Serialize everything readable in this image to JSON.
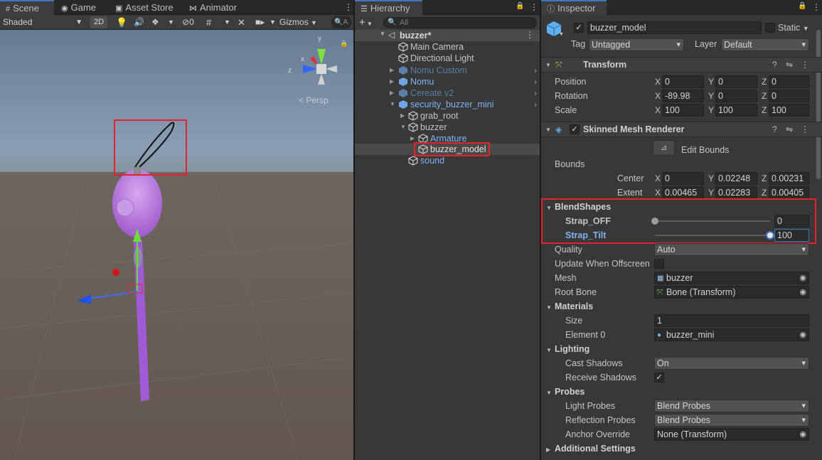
{
  "scene": {
    "tabs": [
      "Scene",
      "Game",
      "Asset Store",
      "Animator"
    ],
    "shading_mode": "Shaded",
    "toggle_2d": "2D",
    "hidden_count": "0",
    "gizmos_label": "Gizmos",
    "search_placeholder": "A",
    "gizmo_axis_y": "y",
    "gizmo_axis_x": "x",
    "gizmo_axis_z": "z",
    "persp_label": "< Persp"
  },
  "hierarchy": {
    "tab": "Hierarchy",
    "add_label": "+",
    "search_placeholder": "All",
    "scene_name": "buzzer*",
    "items": [
      {
        "label": "Main Camera"
      },
      {
        "label": "Directional Light"
      },
      {
        "label": "Nomu Custom"
      },
      {
        "label": "Nomu"
      },
      {
        "label": "Cereate v2"
      },
      {
        "label": "security_buzzer_mini"
      },
      {
        "label": "grab_root"
      },
      {
        "label": "buzzer"
      },
      {
        "label": "Armature"
      },
      {
        "label": "buzzer_model"
      },
      {
        "label": "sound"
      }
    ]
  },
  "inspector": {
    "tab": "Inspector",
    "object_name": "buzzer_model",
    "static_label": "Static",
    "tag_label": "Tag",
    "tag_value": "Untagged",
    "layer_label": "Layer",
    "layer_value": "Default",
    "transform": {
      "title": "Transform",
      "position_label": "Position",
      "rotation_label": "Rotation",
      "scale_label": "Scale",
      "position": [
        "0",
        "0",
        "0"
      ],
      "rotation": [
        "-89.98",
        "0",
        "0"
      ],
      "scale": [
        "100",
        "100",
        "100"
      ]
    },
    "smr": {
      "title": "Skinned Mesh Renderer",
      "edit_bounds": "Edit Bounds",
      "bounds_label": "Bounds",
      "center_label": "Center",
      "extent_label": "Extent",
      "center": [
        "0",
        "0.02248",
        "0.00231"
      ],
      "extent": [
        "0.00465",
        "0.02283",
        "0.00405"
      ],
      "blendshapes_label": "BlendShapes",
      "blendshapes": [
        {
          "name": "Strap_OFF",
          "value": "0",
          "fraction": 0.0
        },
        {
          "name": "Strap_Tilt",
          "value": "100",
          "fraction": 1.0
        }
      ],
      "quality_label": "Quality",
      "quality_value": "Auto",
      "update_offscreen_label": "Update When Offscreen",
      "mesh_label": "Mesh",
      "mesh_value": "buzzer",
      "root_bone_label": "Root Bone",
      "root_bone_value": "Bone (Transform)",
      "materials_label": "Materials",
      "size_label": "Size",
      "size_value": "1",
      "element0_label": "Element 0",
      "element0_value": "buzzer_mini",
      "lighting_label": "Lighting",
      "cast_shadows_label": "Cast Shadows",
      "cast_shadows_value": "On",
      "receive_shadows_label": "Receive Shadows",
      "probes_label": "Probes",
      "light_probes_label": "Light Probes",
      "light_probes_value": "Blend Probes",
      "reflection_probes_label": "Reflection Probes",
      "reflection_probes_value": "Blend Probes",
      "anchor_override_label": "Anchor Override",
      "anchor_override_value": "None (Transform)",
      "additional_settings_label": "Additional Settings"
    }
  },
  "colors": {
    "accent": "#3a79bb",
    "highlight": "#e2242c",
    "blue_text": "#7fb3f5"
  }
}
